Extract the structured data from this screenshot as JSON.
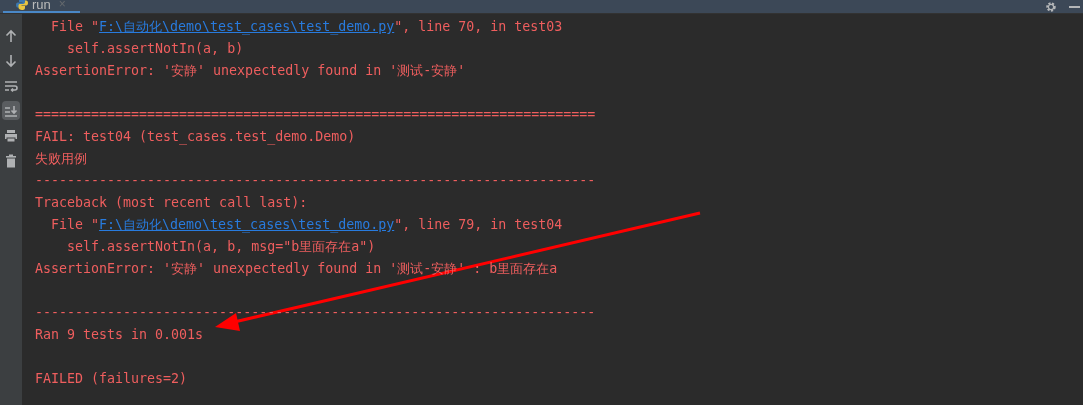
{
  "tab": {
    "label": "run",
    "close": "×",
    "selected": true
  },
  "toolbar": [
    {
      "kind": "up",
      "selected": false
    },
    {
      "kind": "down",
      "selected": false
    },
    {
      "kind": "wrap",
      "selected": false
    },
    {
      "kind": "scroll",
      "selected": true
    },
    {
      "kind": "print",
      "selected": false
    },
    {
      "kind": "trash",
      "selected": false
    }
  ],
  "console_lines": [
    {
      "kind": "file",
      "prefix": "  File \"",
      "link": "F:\\自动化\\demo\\test_cases\\test_demo.py",
      "suffix": "\", line 70, in test03"
    },
    {
      "kind": "text",
      "text": "    self.assertNotIn(a, b)"
    },
    {
      "kind": "text",
      "text": "AssertionError: '安静' unexpectedly found in '测试-安静'"
    },
    {
      "kind": "blank"
    },
    {
      "kind": "rule",
      "text": "======================================================================"
    },
    {
      "kind": "text",
      "text": "FAIL: test04 (test_cases.test_demo.Demo)"
    },
    {
      "kind": "text",
      "text": "失败用例"
    },
    {
      "kind": "rule",
      "text": "----------------------------------------------------------------------"
    },
    {
      "kind": "text",
      "text": "Traceback (most recent call last):"
    },
    {
      "kind": "file",
      "prefix": "  File \"",
      "link": "F:\\自动化\\demo\\test_cases\\test_demo.py",
      "suffix": "\", line 79, in test04"
    },
    {
      "kind": "text",
      "text": "    self.assertNotIn(a, b, msg=\"b里面存在a\")"
    },
    {
      "kind": "text",
      "text": "AssertionError: '安静' unexpectedly found in '测试-安静' : b里面存在a"
    },
    {
      "kind": "blank"
    },
    {
      "kind": "rule",
      "text": "----------------------------------------------------------------------"
    },
    {
      "kind": "text",
      "text": "Ran 9 tests in 0.001s"
    },
    {
      "kind": "blank"
    },
    {
      "kind": "text",
      "text": "FAILED (failures=2)"
    }
  ]
}
